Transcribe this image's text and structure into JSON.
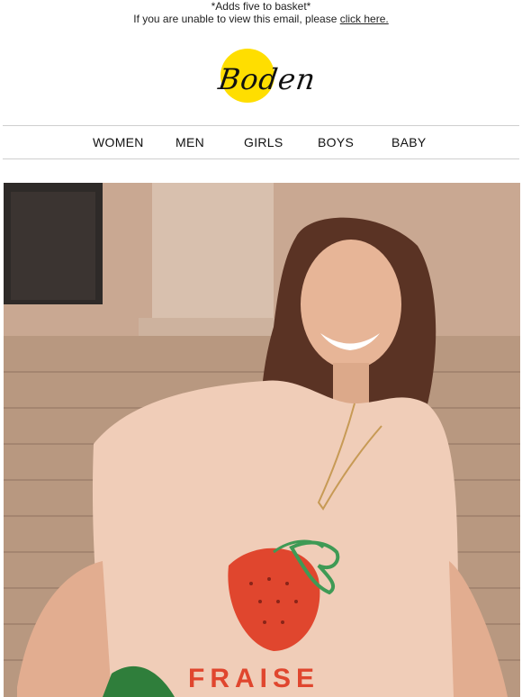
{
  "preheader": {
    "line1": "*Adds five to basket*",
    "line2_prefix": "If you are unable to view this email, please ",
    "link": "click here."
  },
  "logo": {
    "text": "Boden",
    "circle_color": "#ffde00"
  },
  "nav": {
    "items": [
      "WOMEN",
      "MEN",
      "GIRLS",
      "BOYS",
      "BABY"
    ]
  },
  "hero": {
    "tshirt_text": "FRAISE",
    "colors": {
      "wall": "#c9a892",
      "tshirt": "#f0cdb8",
      "strawberry": "#e0462e",
      "leaves": "#3f9a55",
      "hair": "#5a3324",
      "skin": "#e7b597"
    }
  }
}
